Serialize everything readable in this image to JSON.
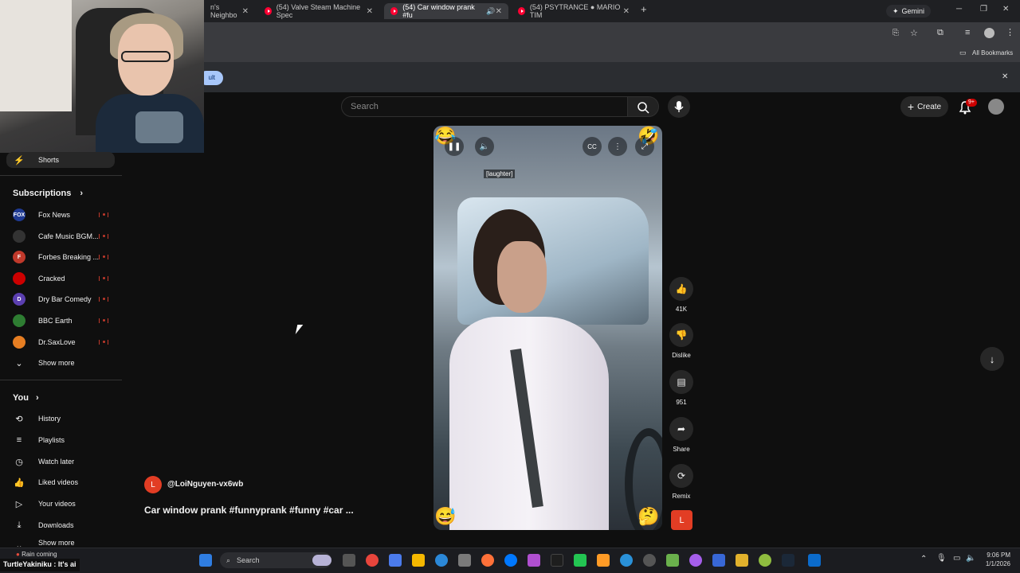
{
  "browser": {
    "tabs": [
      {
        "label": "n's Neighbo",
        "active": false
      },
      {
        "label": "(54) Valve Steam Machine Spec",
        "active": false
      },
      {
        "label": "(54) Car window prank #fu",
        "active": true
      },
      {
        "label": "(54) PSYTRANCE ● MARIO TIM",
        "active": false
      }
    ],
    "new_tab": "+",
    "gemini_label": "Gemini",
    "bookmarks_label": "All Bookmarks",
    "infobar_button": "ult",
    "infobar_close": "✕"
  },
  "youtube": {
    "search_placeholder": "Search",
    "create_label": "Create",
    "notif_badge": "9+"
  },
  "sidebar": {
    "shorts_label": "Shorts",
    "subscriptions_title": "Subscriptions",
    "subscriptions": [
      {
        "name": "Fox News",
        "color": "#1f3a93",
        "initial": "FOX"
      },
      {
        "name": "Cafe Music BGM...",
        "color": "#333333",
        "initial": ""
      },
      {
        "name": "Forbes Breaking ...",
        "color": "#c0392b",
        "initial": "F"
      },
      {
        "name": "Cracked",
        "color": "#cc0000",
        "initial": ""
      },
      {
        "name": "Dry Bar Comedy",
        "color": "#5b3fb0",
        "initial": "D"
      },
      {
        "name": "BBC Earth",
        "color": "#2e7d32",
        "initial": ""
      },
      {
        "name": "Dr.SaxLove",
        "color": "#e67e22",
        "initial": ""
      }
    ],
    "show_more": "Show more",
    "you_title": "You",
    "you_items": [
      {
        "label": "History",
        "icon": "history-icon",
        "glyph": "⟲"
      },
      {
        "label": "Playlists",
        "icon": "playlists-icon",
        "glyph": "≡"
      },
      {
        "label": "Watch later",
        "icon": "watch-later-icon",
        "glyph": "◷"
      },
      {
        "label": "Liked videos",
        "icon": "liked-videos-icon",
        "glyph": "👍"
      },
      {
        "label": "Your videos",
        "icon": "your-videos-icon",
        "glyph": "▷"
      },
      {
        "label": "Downloads",
        "icon": "downloads-icon",
        "glyph": "⤓"
      }
    ],
    "show_more_2": "Show more"
  },
  "short": {
    "caption": "[laughter]",
    "channel_handle": "@LoiNguyen-vx6wb",
    "channel_initial": "L",
    "title": "Car window prank #funnyprank #funny #car ...",
    "likes": "41K",
    "dislike_label": "Dislike",
    "comments": "951",
    "share_label": "Share",
    "remix_label": "Remix"
  },
  "taskbar": {
    "weather": "Rain coming",
    "search_label": "Search",
    "time": "9:06 PM",
    "date": "1/1/2026",
    "ticker": "TurtleYakiniku : It's ai"
  }
}
